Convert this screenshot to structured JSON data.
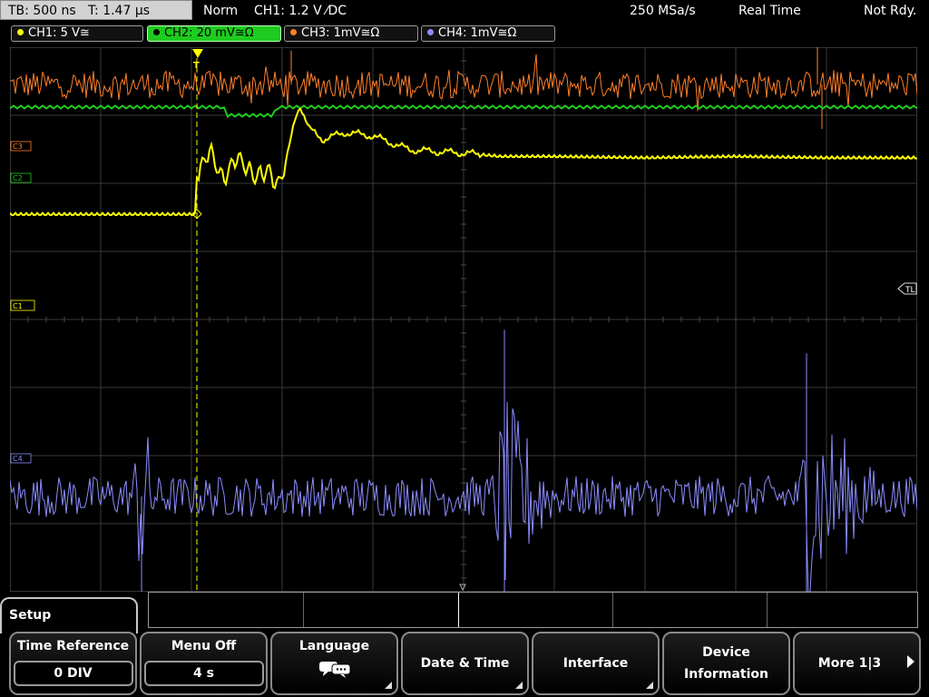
{
  "status_bar": {
    "timebase": "TB: 500 ns   T: 1.47 µs",
    "trigger_mode": "Norm",
    "trigger_info": "CH1: 1.2 V ⁄DC",
    "sample_rate": "250 MSa/s",
    "acq_mode": "Real Time",
    "status": "Not Rdy."
  },
  "channels": [
    {
      "label": "CH1: 5 V≅",
      "color": "#ffff00"
    },
    {
      "label": "CH2: 20 mV≅Ω",
      "color": "#1ecb1e"
    },
    {
      "label": "CH3: 1mV≅Ω",
      "color": "#ff7f2a"
    },
    {
      "label": "CH4: 1mV≅Ω",
      "color": "#8c8cff"
    }
  ],
  "markers": {
    "ch1": "C1",
    "ch2": "C2",
    "ch3": "C3",
    "ch4": "C4",
    "trigger_level": "TL",
    "trigger": "T"
  },
  "chart_data": {
    "type": "line",
    "title": "",
    "xlabel": "",
    "ylabel": "",
    "x_unit": "div",
    "y_unit": "div",
    "xlim": [
      0,
      10
    ],
    "ylim": [
      0,
      8
    ],
    "grid": true,
    "grid_divisions": {
      "x": 10,
      "y": 8
    },
    "trigger_position_div": 2.06,
    "trigger_level_div": 5.55,
    "series": [
      {
        "name": "CH1",
        "color": "#ffff00",
        "points": [
          [
            0,
            5.55
          ],
          [
            2.05,
            5.55
          ],
          [
            2.06,
            6.1
          ],
          [
            2.2,
            6.5
          ],
          [
            2.35,
            6.05
          ],
          [
            2.5,
            6.4
          ],
          [
            2.7,
            6.1
          ],
          [
            2.85,
            6.2
          ],
          [
            2.95,
            5.95
          ],
          [
            3.05,
            6.35
          ],
          [
            3.15,
            7.0
          ],
          [
            3.2,
            7.15
          ],
          [
            3.3,
            6.8
          ],
          [
            3.45,
            6.65
          ],
          [
            3.7,
            6.75
          ],
          [
            4.0,
            6.7
          ],
          [
            4.1,
            6.65
          ],
          [
            4.4,
            6.5
          ],
          [
            4.7,
            6.47
          ],
          [
            5.0,
            6.45
          ],
          [
            5.4,
            6.4
          ],
          [
            6.0,
            6.4
          ],
          [
            7.0,
            6.38
          ],
          [
            8.0,
            6.4
          ],
          [
            9.0,
            6.38
          ],
          [
            10,
            6.38
          ]
        ]
      },
      {
        "name": "CH2",
        "color": "#1ecb1e",
        "points": [
          [
            0,
            7.12
          ],
          [
            2.35,
            7.12
          ],
          [
            2.4,
            7.0
          ],
          [
            2.9,
            7.0
          ],
          [
            2.95,
            7.12
          ],
          [
            10,
            7.12
          ]
        ],
        "noise_amplitude_div": 0.02
      },
      {
        "name": "CH3",
        "color": "#ff7f2a",
        "baseline_div": 7.45,
        "noise_amplitude_div": 0.2,
        "spikes": [
          {
            "x": 3.1,
            "y": 7.95
          },
          {
            "x": 8.9,
            "y": 8.25
          },
          {
            "x": 8.95,
            "y": 6.8
          }
        ]
      },
      {
        "name": "CH4",
        "color": "#8c8cff",
        "baseline_div": 1.4,
        "noise_amplitude_div": 0.3,
        "bursts": [
          {
            "start": 1.35,
            "end": 1.6,
            "peak_x": 1.45,
            "peak_div": 1.4,
            "trough_div": -0.2
          },
          {
            "start": 5.3,
            "end": 6.0,
            "peak_x": 5.45,
            "peak_div": 3.85,
            "trough_div": -1.0
          },
          {
            "start": 8.7,
            "end": 9.6,
            "peak_x": 8.78,
            "peak_div": 3.5,
            "trough_div": -1.0
          }
        ]
      }
    ]
  },
  "menu": {
    "tab_label": "Setup",
    "softkeys": [
      {
        "label": "Time Reference",
        "value": "0 DIV"
      },
      {
        "label": "Menu Off",
        "value": "4 s"
      },
      {
        "label": "Language"
      },
      {
        "label": "Date & Time"
      },
      {
        "label": "Interface"
      },
      {
        "label": "Device Information"
      },
      {
        "label": "More 1|3"
      }
    ]
  }
}
